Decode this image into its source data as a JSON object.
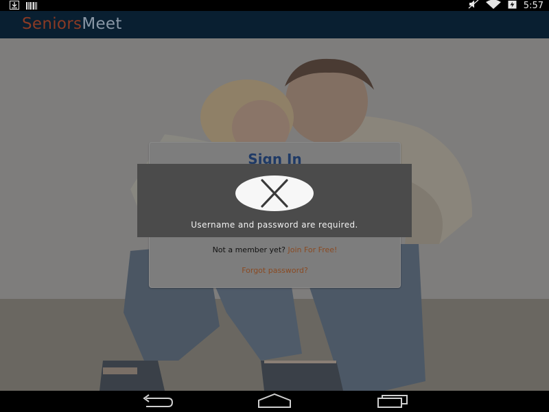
{
  "status_bar": {
    "time": "5:57",
    "icons_left": [
      "download-icon",
      "barcode-icon"
    ],
    "icons_right": [
      "mute-icon",
      "wifi-icon",
      "battery-charging-icon"
    ]
  },
  "app": {
    "brand_part1": "Seniors",
    "brand_part2": "Meet",
    "colors": {
      "brand_part1": "#8a3a24",
      "brand_part2": "#8a97a6",
      "app_bar": "#091f31"
    }
  },
  "signin": {
    "title": "Sign In",
    "join_prompt": "Not a member yet?",
    "join_link": "Join For Free!",
    "forgot": "Forgot password?"
  },
  "error": {
    "icon": "close-icon",
    "message": "Username and password are required."
  },
  "nav": {
    "buttons": [
      "back-icon",
      "home-icon",
      "recents-icon"
    ]
  }
}
